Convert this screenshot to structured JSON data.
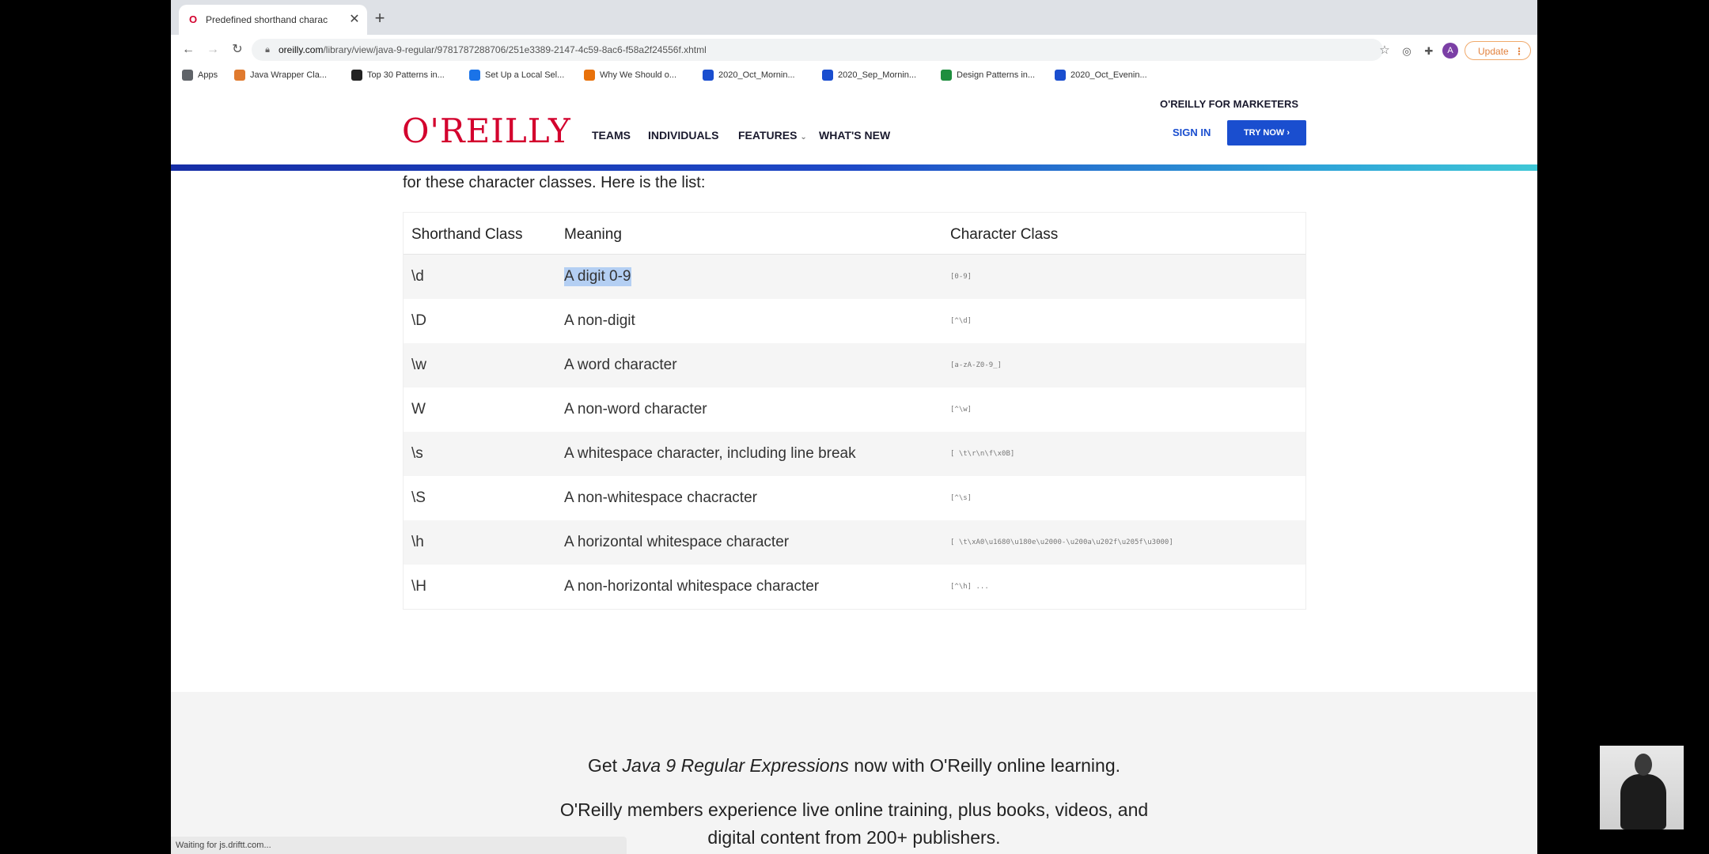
{
  "browser": {
    "tab_title": "Predefined shorthand charac",
    "tab_favicon": "O",
    "url_host": "oreilly.com",
    "url_path": "/library/view/java-9-regular/9781787288706/251e3389-2147-4c59-8ac6-f58a2f24556f.xhtml",
    "update_label": "Update",
    "avatar_letter": "A",
    "status_text": "Waiting for js.driftt.com..."
  },
  "bookmarks": [
    {
      "label": "Apps",
      "icon_color": "#5f6368"
    },
    {
      "label": "Java Wrapper Cla...",
      "icon_color": "#e07a2e"
    },
    {
      "label": "Top 30 Patterns in...",
      "icon_color": "#222222"
    },
    {
      "label": "Set Up a Local Sel...",
      "icon_color": "#1a73e8"
    },
    {
      "label": "Why We Should o...",
      "icon_color": "#e8710a"
    },
    {
      "label": "2020_Oct_Mornin...",
      "icon_color": "#1a4ecf"
    },
    {
      "label": "2020_Sep_Mornin...",
      "icon_color": "#1a4ecf"
    },
    {
      "label": "Design Patterns in...",
      "icon_color": "#1e8e3e"
    },
    {
      "label": "2020_Oct_Evenin...",
      "icon_color": "#1a4ecf"
    }
  ],
  "header": {
    "logo": "O'REILLY",
    "nav": [
      "TEAMS",
      "INDIVIDUALS",
      "FEATURES",
      "WHAT'S NEW"
    ],
    "marketers": "O'REILLY FOR MARKETERS",
    "sign_in": "SIGN IN",
    "try_now": "TRY NOW"
  },
  "content": {
    "intro": "for these character classes. Here is the list:",
    "columns": [
      "Shorthand Class",
      "Meaning",
      "Character Class"
    ],
    "rows": [
      {
        "shorthand": "\\d",
        "meaning": "A digit 0-9",
        "char_class": "[0-9]"
      },
      {
        "shorthand": "\\D",
        "meaning": "A non-digit",
        "char_class": "[^\\d]"
      },
      {
        "shorthand": "\\w",
        "meaning": "A word character",
        "char_class": "[a-zA-Z0-9_]"
      },
      {
        "shorthand": "W",
        "meaning": "A non-word character",
        "char_class": "[^\\w]"
      },
      {
        "shorthand": "\\s",
        "meaning": "A whitespace character, including line break",
        "char_class": "[ \\t\\r\\n\\f\\x0B]"
      },
      {
        "shorthand": "\\S",
        "meaning": "A non-whitespace chacracter",
        "char_class": "[^\\s]"
      },
      {
        "shorthand": "\\h",
        "meaning": "A horizontal whitespace character",
        "char_class": "[ \\t\\xA0\\u1680\\u180e\\u2000-\\u200a\\u202f\\u205f\\u3000]"
      },
      {
        "shorthand": "\\H",
        "meaning": "A non-horizontal whitespace character",
        "char_class": "[^\\h] ..."
      }
    ]
  },
  "promo": {
    "line1_pre": "Get ",
    "line1_title": "Java 9 Regular Expressions",
    "line1_post": " now with O'Reilly online learning.",
    "line2": "O'Reilly members experience live online training, plus books, videos, and",
    "line3": "digital content from 200+ publishers."
  }
}
